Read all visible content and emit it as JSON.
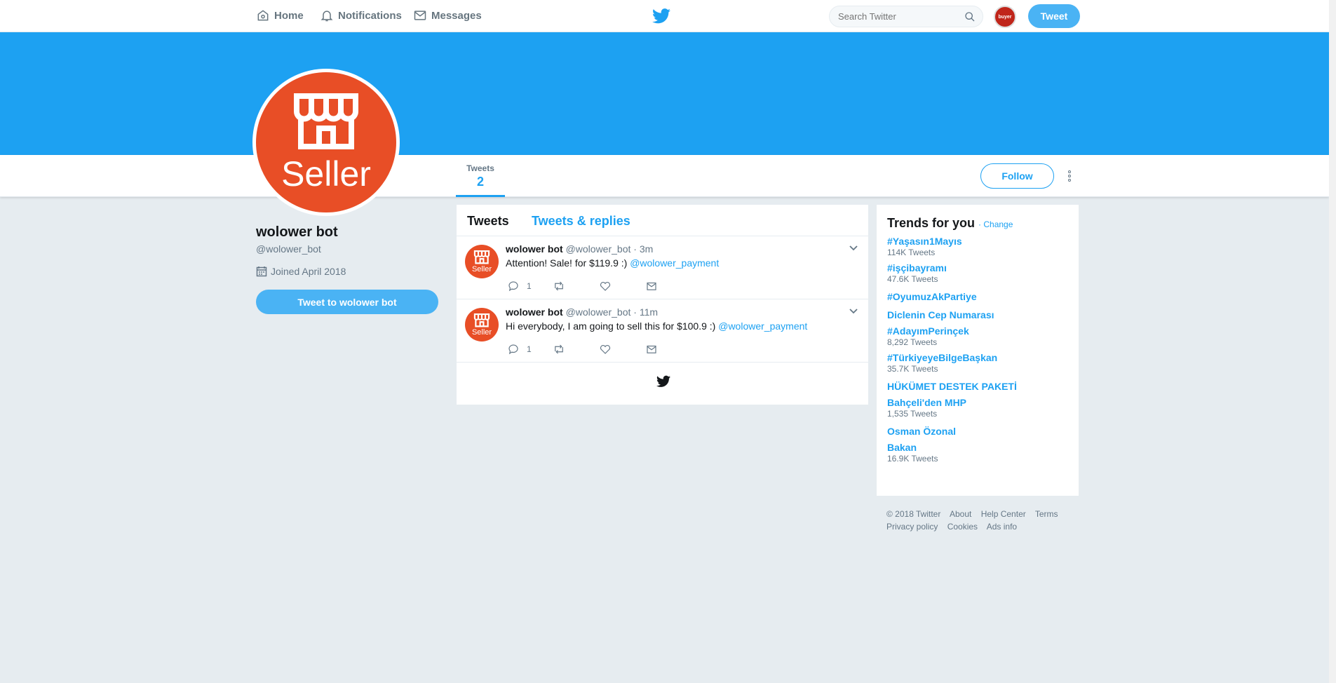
{
  "nav": {
    "home": "Home",
    "notifications": "Notifications",
    "messages": "Messages",
    "search_placeholder": "Search Twitter",
    "avatar_text": "buyer",
    "tweet_button": "Tweet"
  },
  "profile": {
    "avatar_text": "Seller",
    "name": "wolower bot",
    "handle": "@wolower_bot",
    "joined": "Joined April 2018",
    "tweet_to": "Tweet to wolower bot",
    "stats": {
      "tweets_label": "Tweets",
      "tweets_value": "2"
    },
    "follow": "Follow"
  },
  "timeline": {
    "tabs": [
      "Tweets",
      "Tweets & replies"
    ],
    "tweets": [
      {
        "name": "wolower bot",
        "handle": "@wolower_bot",
        "time": "· 3m",
        "text": "Attention! Sale! for $119.9 :)",
        "mention": "@wolower_payment",
        "replies": "1",
        "avatar_text": "Seller"
      },
      {
        "name": "wolower bot",
        "handle": "@wolower_bot",
        "time": "· 11m",
        "text": "Hi everybody, I am going to sell this for $100.9 :)",
        "mention": "@wolower_payment",
        "replies": "1",
        "avatar_text": "Seller"
      }
    ]
  },
  "trends": {
    "title": "Trends for you",
    "change": "· Change",
    "items": [
      {
        "name": "#Yaşasın1Mayıs",
        "count": "114K Tweets"
      },
      {
        "name": "#işçibayramı",
        "count": "47.6K Tweets"
      },
      {
        "name": "#OyumuzAkPartiye",
        "count": ""
      },
      {
        "name": "Diclenin Cep Numarası",
        "count": ""
      },
      {
        "name": "#AdayımPerinçek",
        "count": "8,292 Tweets"
      },
      {
        "name": "#TürkiyeyeBilgeBaşkan",
        "count": "35.7K Tweets"
      },
      {
        "name": "HÜKÜMET DESTEK PAKETİ",
        "count": ""
      },
      {
        "name": "Bahçeli'den MHP",
        "count": "1,535 Tweets"
      },
      {
        "name": "Osman Özonal",
        "count": ""
      },
      {
        "name": "Bakan",
        "count": "16.9K Tweets"
      }
    ]
  },
  "footer": {
    "line1": [
      "© 2018 Twitter",
      "About",
      "Help Center",
      "Terms"
    ],
    "line2": [
      "Privacy policy",
      "Cookies",
      "Ads info"
    ]
  },
  "colors": {
    "accent": "#1da1f2",
    "avatar_bg": "#e84e26",
    "page_bg": "#e6ecf0"
  }
}
